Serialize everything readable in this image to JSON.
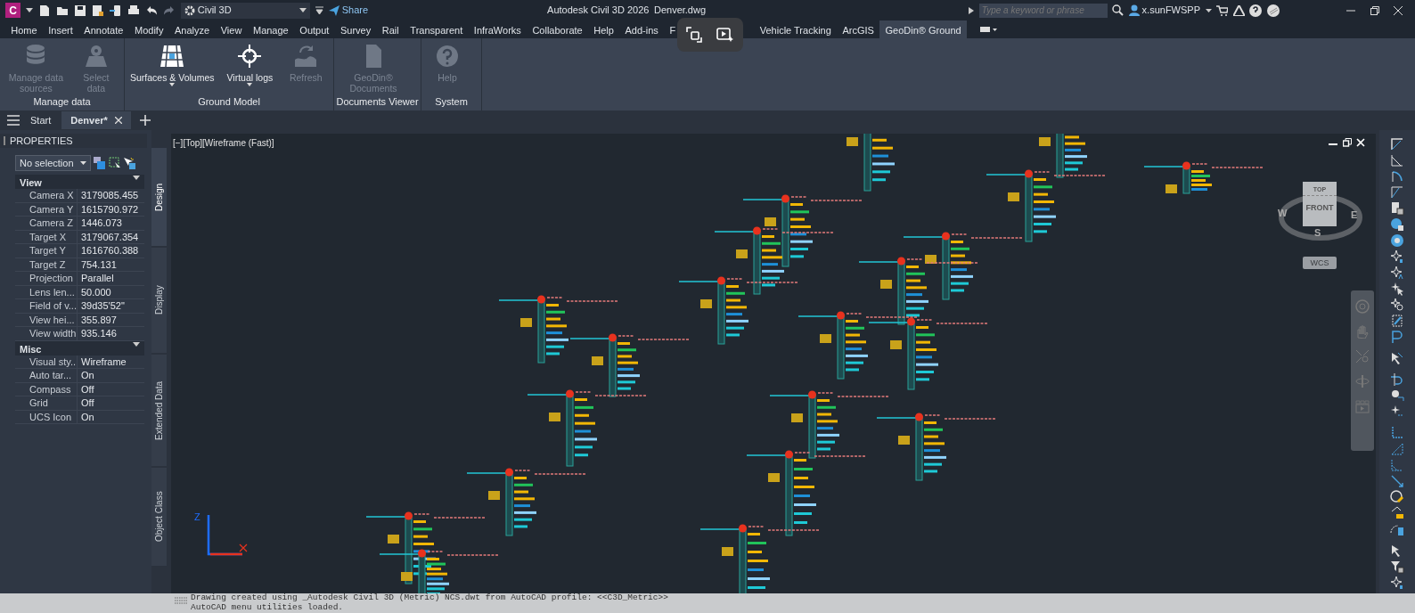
{
  "title_bar": {
    "app_letter": "C",
    "workspace": "Civil 3D",
    "share": "Share",
    "app_title": "Autodesk Civil 3D 2026",
    "file_name": "Denver.dwg",
    "search": {
      "placeholder": "Type a keyword or phrase"
    },
    "user": "x.sunFWSPP"
  },
  "ribbon_tabs": [
    {
      "label": "Home",
      "selected": false
    },
    {
      "label": "Insert",
      "selected": false
    },
    {
      "label": "Annotate",
      "selected": false
    },
    {
      "label": "Modify",
      "selected": false
    },
    {
      "label": "Analyze",
      "selected": false
    },
    {
      "label": "View",
      "selected": false
    },
    {
      "label": "Manage",
      "selected": false
    },
    {
      "label": "Output",
      "selected": false
    },
    {
      "label": "Survey",
      "selected": false
    },
    {
      "label": "Rail",
      "selected": false
    },
    {
      "label": "Transparent",
      "selected": false
    },
    {
      "label": "InfraWorks",
      "selected": false
    },
    {
      "label": "Collaborate",
      "selected": false
    },
    {
      "label": "Help",
      "selected": false
    },
    {
      "label": "Add-ins",
      "selected": false
    },
    {
      "label": "F",
      "selected": false
    },
    {
      "label": "Vehicle Tracking",
      "selected": false
    },
    {
      "label": "ArcGIS",
      "selected": false
    },
    {
      "label": "GeoDin® Ground",
      "selected": true
    }
  ],
  "ribbon_panels": [
    {
      "title": "Manage data",
      "buttons": [
        {
          "label": "Manage data sources",
          "disabled": true,
          "dropdown": false
        },
        {
          "label": "Select data",
          "disabled": true,
          "dropdown": false
        }
      ]
    },
    {
      "title": "Ground Model",
      "buttons": [
        {
          "label": "Surfaces & Volumes",
          "disabled": false,
          "dropdown": true
        },
        {
          "label": "Virtual logs",
          "disabled": false,
          "dropdown": true
        },
        {
          "label": "Refresh",
          "disabled": true,
          "dropdown": false
        }
      ]
    },
    {
      "title": "Documents Viewer",
      "buttons": [
        {
          "label": "GeoDin® Documents",
          "disabled": true,
          "dropdown": false
        }
      ]
    },
    {
      "title": "System",
      "buttons": [
        {
          "label": "Help",
          "disabled": true,
          "dropdown": false
        }
      ]
    }
  ],
  "file_tabs": [
    {
      "label": "Start",
      "selected": false,
      "closable": false
    },
    {
      "label": "Denver*",
      "selected": true,
      "closable": true
    }
  ],
  "properties": {
    "title": "PROPERTIES",
    "selection": "No selection",
    "sections": [
      {
        "title": "View",
        "expanded": true,
        "rows": [
          {
            "name": "Camera X",
            "value": "3179085.455"
          },
          {
            "name": "Camera Y",
            "value": "1615790.972"
          },
          {
            "name": "Camera Z",
            "value": "1446.073"
          },
          {
            "name": "Target X",
            "value": "3179067.354"
          },
          {
            "name": "Target Y",
            "value": "1616760.388"
          },
          {
            "name": "Target Z",
            "value": "754.131"
          },
          {
            "name": "Projection",
            "value": "Parallel"
          },
          {
            "name": "Lens len...",
            "value": "50.000"
          },
          {
            "name": "Field of v...",
            "value": "39d35'52\""
          },
          {
            "name": "View hei...",
            "value": "355.897"
          },
          {
            "name": "View width",
            "value": "935.146"
          }
        ]
      },
      {
        "title": "Misc",
        "expanded": true,
        "rows": [
          {
            "name": "Visual sty...",
            "value": "Wireframe"
          },
          {
            "name": "Auto tar...",
            "value": "On"
          },
          {
            "name": "Compass",
            "value": "Off"
          },
          {
            "name": "Grid",
            "value": "Off"
          },
          {
            "name": "UCS Icon",
            "value": "On"
          }
        ]
      }
    ],
    "side_tabs": [
      {
        "label": "Design",
        "selected": true
      },
      {
        "label": "Display",
        "selected": false
      },
      {
        "label": "Extended Data",
        "selected": false
      },
      {
        "label": "Object Class",
        "selected": false
      }
    ]
  },
  "viewport": {
    "label": "[−][Top][Wireframe (Fast)]",
    "viewcube": {
      "top": "TOP",
      "front": "FRONT",
      "west": "W",
      "east": "E",
      "south": "S",
      "ucs": "WCS"
    },
    "ucs_axis": "Z"
  },
  "command_line": {
    "lines": [
      "Drawing created using _Autodesk Civil 3D (Metric) NCS.dwt from AutoCAD profile: <<C3D_Metric>>",
      "AutoCAD menu utilities loaded."
    ]
  }
}
